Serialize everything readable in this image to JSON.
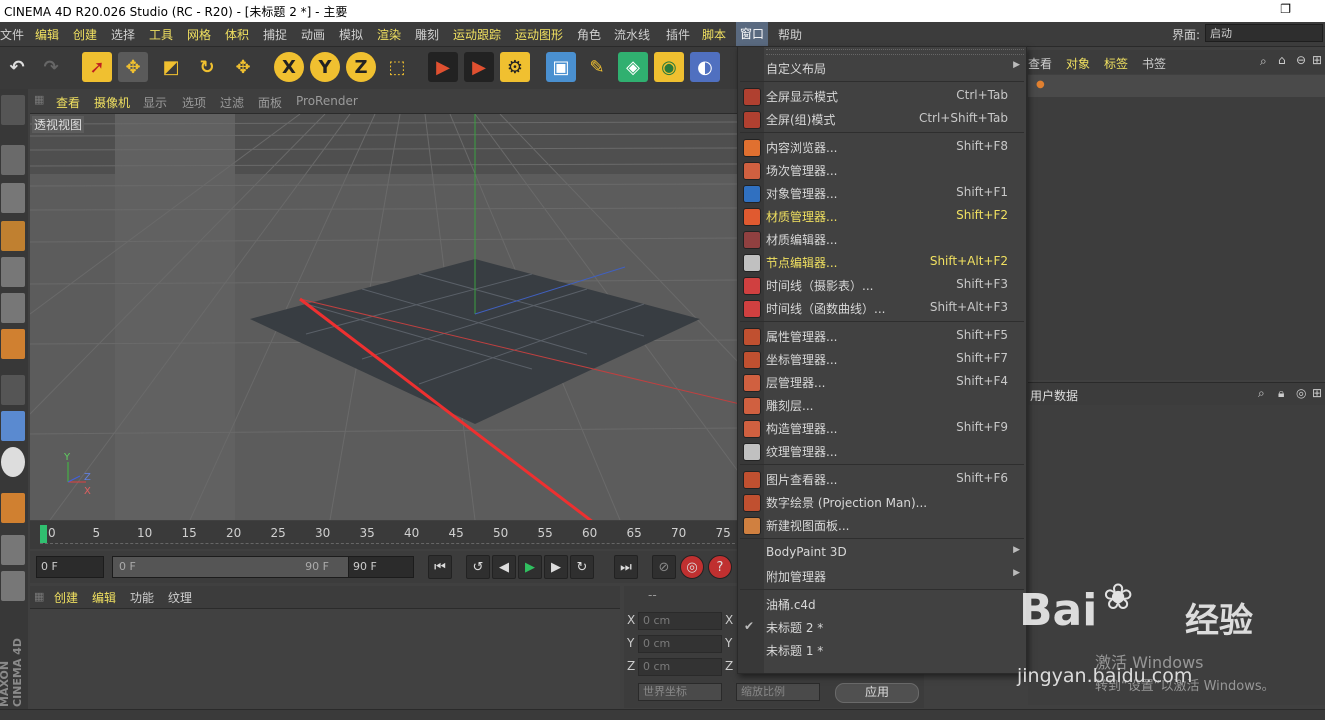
{
  "window": {
    "title": "CINEMA 4D R20.026 Studio (RC - R20) - [未标题 2 *] - 主要"
  },
  "menubar": {
    "items": [
      {
        "label": "文件",
        "hl": false
      },
      {
        "label": "编辑",
        "hl": true
      },
      {
        "label": "创建",
        "hl": true
      },
      {
        "label": "选择",
        "hl": false
      },
      {
        "label": "工具",
        "hl": true
      },
      {
        "label": "网格",
        "hl": true
      },
      {
        "label": "体积",
        "hl": true
      },
      {
        "label": "捕捉",
        "hl": false
      },
      {
        "label": "动画",
        "hl": false
      },
      {
        "label": "模拟",
        "hl": false
      },
      {
        "label": "渲染",
        "hl": true
      },
      {
        "label": "雕刻",
        "hl": false
      },
      {
        "label": "运动跟踪",
        "hl": true
      },
      {
        "label": "运动图形",
        "hl": true
      },
      {
        "label": "角色",
        "hl": false
      },
      {
        "label": "流水线",
        "hl": false
      },
      {
        "label": "插件",
        "hl": false
      },
      {
        "label": "脚本",
        "hl": true
      },
      {
        "label": "窗口",
        "hl": true
      },
      {
        "label": "帮助",
        "hl": false
      }
    ],
    "layout_label": "界面:",
    "layout_value": "启动"
  },
  "viewport": {
    "menu": [
      "查看",
      "摄像机",
      "显示",
      "选项",
      "过滤",
      "面板",
      "ProRender"
    ],
    "label": "透视视图",
    "axes": {
      "y": "Y",
      "z": "Z",
      "x": "X"
    }
  },
  "timeline": {
    "ticks": [
      "0",
      "5",
      "10",
      "15",
      "20",
      "25",
      "30",
      "35",
      "40",
      "45",
      "50",
      "55",
      "60",
      "65",
      "70",
      "75"
    ]
  },
  "transport": {
    "current": "0 F",
    "range_start": "0 F",
    "range_end": "90 F",
    "end": "90 F"
  },
  "material_panel": {
    "menu": [
      "创建",
      "编辑",
      "功能",
      "纹理"
    ]
  },
  "coord_panel": {
    "header": "--",
    "rows": [
      {
        "axis": "X",
        "value": "0 cm",
        "axis2": "X"
      },
      {
        "axis": "Y",
        "value": "0 cm",
        "axis2": "Y"
      },
      {
        "axis": "Z",
        "value": "0 cm",
        "axis2": "Z"
      }
    ],
    "world": "世界坐标",
    "scale": "缩放比例",
    "apply": "应用"
  },
  "object_panel": {
    "menu": [
      "查看",
      "对象",
      "标签",
      "书签"
    ]
  },
  "attr_panel": {
    "label": "用户数据"
  },
  "window_menu": {
    "items": [
      {
        "label": "自定义布局",
        "shortcut": "",
        "hl": false,
        "arrow": true,
        "icon": "",
        "color": ""
      },
      {
        "sep": true
      },
      {
        "label": "全屏显示模式",
        "shortcut": "Ctrl+Tab",
        "hl": false,
        "icon": "fullscreen-icon",
        "color": "#b04030"
      },
      {
        "label": "全屏(组)模式",
        "shortcut": "Ctrl+Shift+Tab",
        "hl": false,
        "icon": "fullscreen-group-icon",
        "color": "#b04030"
      },
      {
        "sep": true
      },
      {
        "label": "内容浏览器...",
        "shortcut": "Shift+F8",
        "hl": false,
        "icon": "content-browser-icon",
        "color": "#e07030"
      },
      {
        "label": "场次管理器...",
        "shortcut": "",
        "hl": false,
        "icon": "take-manager-icon",
        "color": "#d06040"
      },
      {
        "label": "对象管理器...",
        "shortcut": "Shift+F1",
        "hl": false,
        "icon": "object-manager-icon",
        "color": "#3070c0"
      },
      {
        "label": "材质管理器...",
        "shortcut": "Shift+F2",
        "hl": true,
        "icon": "material-manager-icon",
        "color": "#e05a30"
      },
      {
        "label": "材质编辑器...",
        "shortcut": "",
        "hl": false,
        "icon": "material-editor-icon",
        "color": "#904040"
      },
      {
        "label": "节点编辑器...",
        "shortcut": "Shift+Alt+F2",
        "hl": true,
        "icon": "node-editor-icon",
        "color": "#c0c0c0"
      },
      {
        "label": "时间线（摄影表）...",
        "shortcut": "Shift+F3",
        "hl": false,
        "icon": "timeline-dopesheet-icon",
        "color": "#d04040"
      },
      {
        "label": "时间线（函数曲线）...",
        "shortcut": "Shift+Alt+F3",
        "hl": false,
        "icon": "timeline-fcurve-icon",
        "color": "#d04040"
      },
      {
        "sep": true
      },
      {
        "label": "属性管理器...",
        "shortcut": "Shift+F5",
        "hl": false,
        "icon": "attribute-manager-icon",
        "color": "#c05030"
      },
      {
        "label": "坐标管理器...",
        "shortcut": "Shift+F7",
        "hl": false,
        "icon": "coordinate-manager-icon",
        "color": "#c05030"
      },
      {
        "label": "层管理器...",
        "shortcut": "Shift+F4",
        "hl": false,
        "icon": "layer-manager-icon",
        "color": "#d06040"
      },
      {
        "label": "雕刻层...",
        "shortcut": "",
        "hl": false,
        "icon": "sculpt-layer-icon",
        "color": "#d06040"
      },
      {
        "label": "构造管理器...",
        "shortcut": "Shift+F9",
        "hl": false,
        "icon": "structure-manager-icon",
        "color": "#d06040"
      },
      {
        "label": "纹理管理器...",
        "shortcut": "",
        "hl": false,
        "icon": "texture-manager-icon",
        "color": "#c0c0c0"
      },
      {
        "sep": true
      },
      {
        "label": "图片查看器...",
        "shortcut": "Shift+F6",
        "hl": false,
        "icon": "picture-viewer-icon",
        "color": "#c05030"
      },
      {
        "label": "数字绘景 (Projection Man)...",
        "shortcut": "",
        "hl": false,
        "icon": "projection-man-icon",
        "color": "#c05030"
      },
      {
        "label": "新建视图面板...",
        "shortcut": "",
        "hl": false,
        "icon": "new-view-panel-icon",
        "color": "#d08040"
      },
      {
        "sep": true
      },
      {
        "label": "BodyPaint 3D",
        "shortcut": "",
        "hl": false,
        "arrow": true,
        "icon": "",
        "color": ""
      },
      {
        "label": "附加管理器",
        "shortcut": "",
        "hl": false,
        "arrow": true,
        "icon": "",
        "color": ""
      },
      {
        "sep": true
      },
      {
        "label": "油桶.c4d",
        "shortcut": "",
        "hl": false,
        "icon": "",
        "color": ""
      },
      {
        "label": "未标题 2 *",
        "shortcut": "",
        "hl": false,
        "check": true,
        "icon": "",
        "color": ""
      },
      {
        "label": "未标题 1 *",
        "shortcut": "",
        "hl": false,
        "icon": "",
        "color": ""
      }
    ]
  },
  "watermark": {
    "brand_a": "Bai",
    "brand_b": "经验",
    "url": "jingyan.baidu.com",
    "activate1": "激活 Windows",
    "activate2": "转到“设置”以激活 Windows。"
  },
  "side_logo": {
    "brand": "MAXON",
    "product": "CINEMA 4D"
  }
}
